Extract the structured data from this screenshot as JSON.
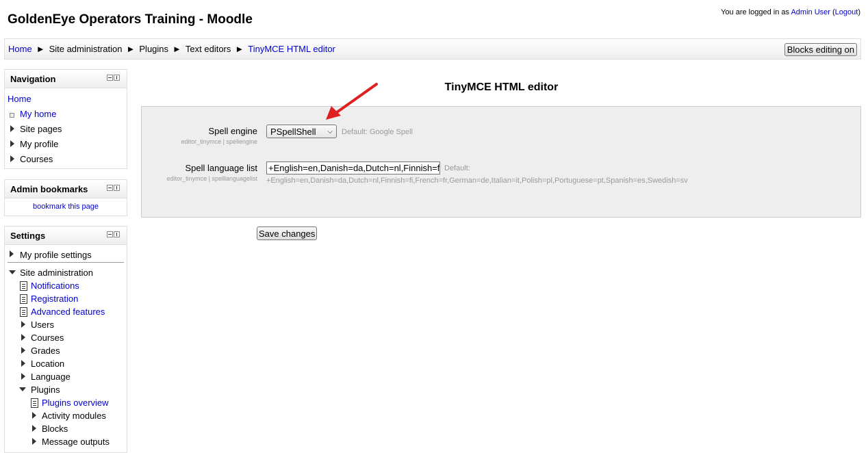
{
  "header": {
    "site_title": "GoldenEye Operators Training - Moodle",
    "login_prefix": "You are logged in as ",
    "user_name": "Admin User",
    "logout_open": " (",
    "logout_label": "Logout",
    "logout_close": ")"
  },
  "breadcrumb": {
    "items": [
      "Home",
      "Site administration",
      "Plugins",
      "Text editors",
      "TinyMCE HTML editor"
    ],
    "separator": "►"
  },
  "toolbar": {
    "blocks_editing_label": "Blocks editing on"
  },
  "navigation": {
    "title": "Navigation",
    "home": "Home",
    "items": [
      "My home",
      "Site pages",
      "My profile",
      "Courses"
    ]
  },
  "admin_bookmarks": {
    "title": "Admin bookmarks",
    "link": "bookmark this page"
  },
  "settings_block": {
    "title": "Settings",
    "items": [
      "My profile settings",
      "Site administration",
      "Notifications",
      "Registration",
      "Advanced features",
      "Users",
      "Courses",
      "Grades",
      "Location",
      "Language",
      "Plugins",
      "Plugins overview",
      "Activity modules",
      "Blocks",
      "Message outputs"
    ]
  },
  "main": {
    "title": "TinyMCE HTML editor",
    "spell_engine": {
      "label": "Spell engine",
      "sublabel": "editor_tinymce | spellengine",
      "value": "PSpellShell",
      "default_note": "Default: Google Spell"
    },
    "spell_language_list": {
      "label": "Spell language list",
      "sublabel": "editor_tinymce | spelllanguagelist",
      "value": "+English=en,Danish=da,Dutch=nl,Finnish=fi",
      "default_prefix": "Default:",
      "default_value": "+English=en,Danish=da,Dutch=nl,Finnish=fi,French=fr,German=de,Italian=it,Polish=pl,Portuguese=pt,Spanish=es,Swedish=sv"
    },
    "save_label": "Save changes"
  },
  "colors": {
    "link": "#0000cc",
    "annotation_arrow": "#e02020"
  }
}
